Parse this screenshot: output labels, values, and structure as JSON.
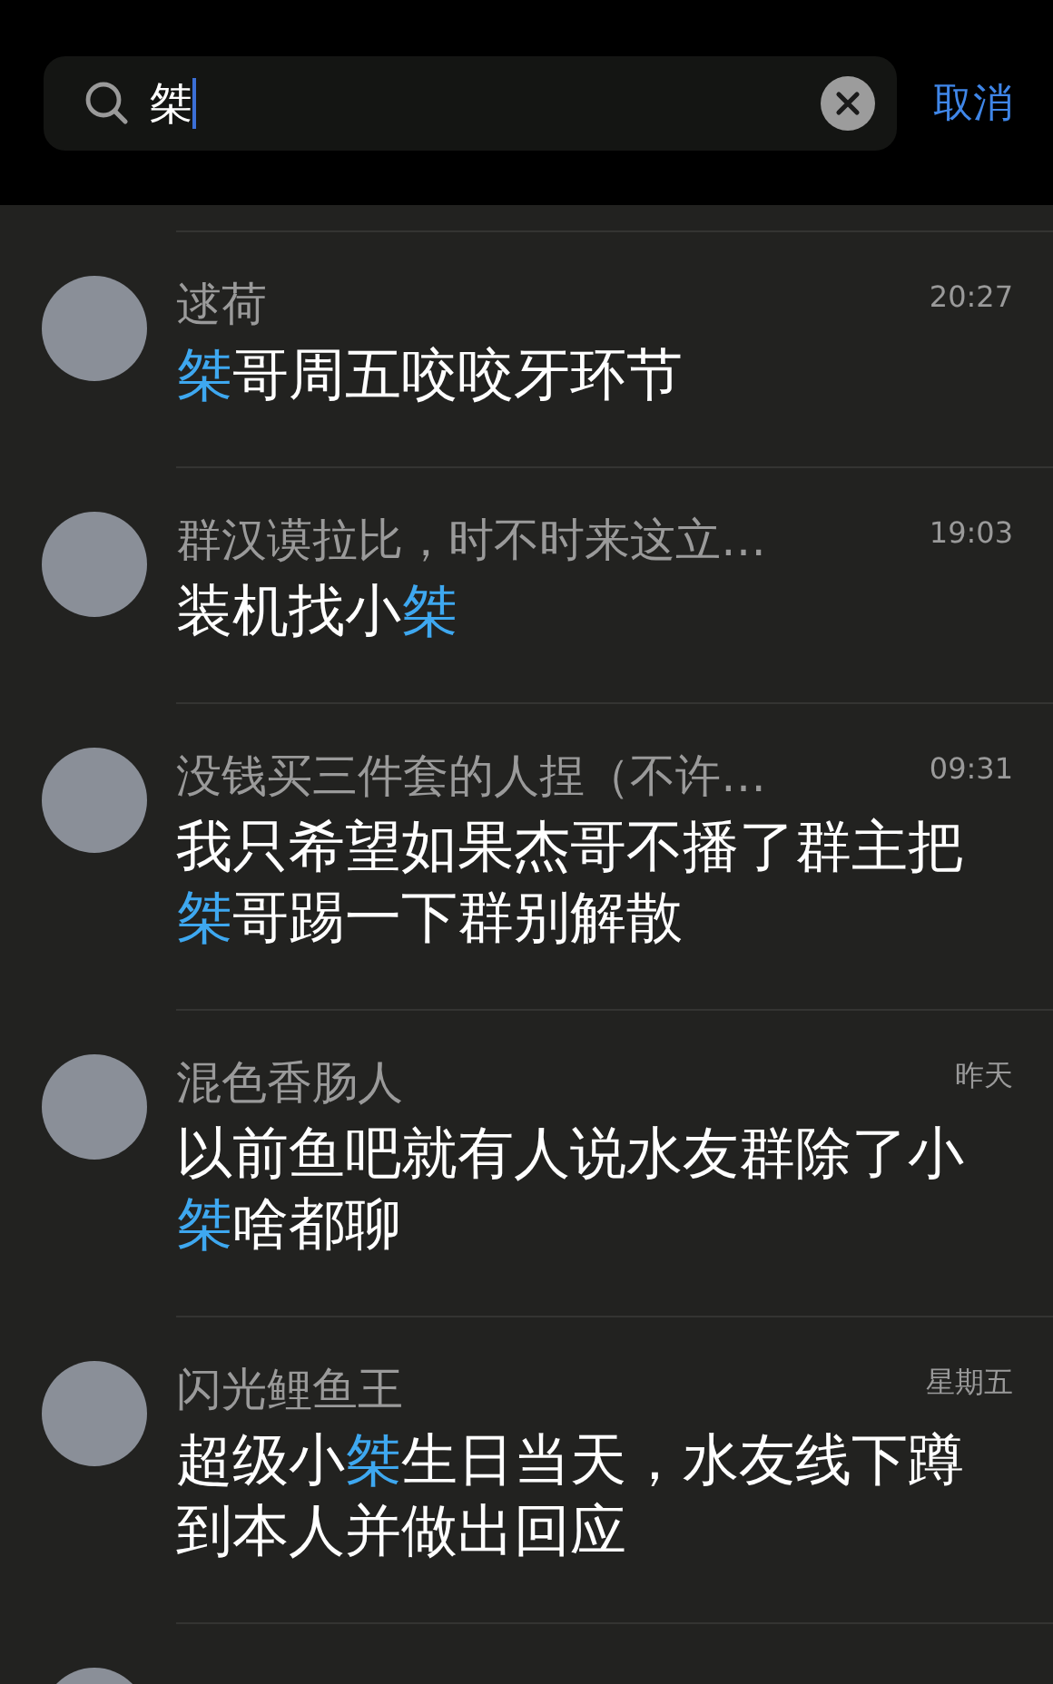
{
  "search": {
    "value": "桀",
    "cancel": "取消"
  },
  "results": [
    {
      "name": "逑荷",
      "time": "20:27",
      "message": [
        {
          "text": "桀",
          "highlight": true
        },
        {
          "text": "哥周五咬咬牙环节",
          "highlight": false
        }
      ]
    },
    {
      "name": "群汉谟拉比，时不时来这立…",
      "time": "19:03",
      "message": [
        {
          "text": "装机找小",
          "highlight": false
        },
        {
          "text": "桀",
          "highlight": true
        }
      ]
    },
    {
      "name": "没钱买三件套的人捏（不许…",
      "time": "09:31",
      "message": [
        {
          "text": "我只希望如果杰哥不播了群主把",
          "highlight": false
        },
        {
          "text": "桀",
          "highlight": true
        },
        {
          "text": "哥踢一下群别解散",
          "highlight": false
        }
      ]
    },
    {
      "name": "混色香肠人",
      "time": "昨天",
      "message": [
        {
          "text": "以前鱼吧就有人说水友群除了小",
          "highlight": false
        },
        {
          "text": "桀",
          "highlight": true
        },
        {
          "text": "啥都聊",
          "highlight": false
        }
      ]
    },
    {
      "name": "闪光鲤鱼王",
      "time": "星期五",
      "message": [
        {
          "text": "超级小",
          "highlight": false
        },
        {
          "text": "桀",
          "highlight": true
        },
        {
          "text": "生日当天，水友线下蹲到本人并做出回应",
          "highlight": false
        }
      ]
    }
  ]
}
